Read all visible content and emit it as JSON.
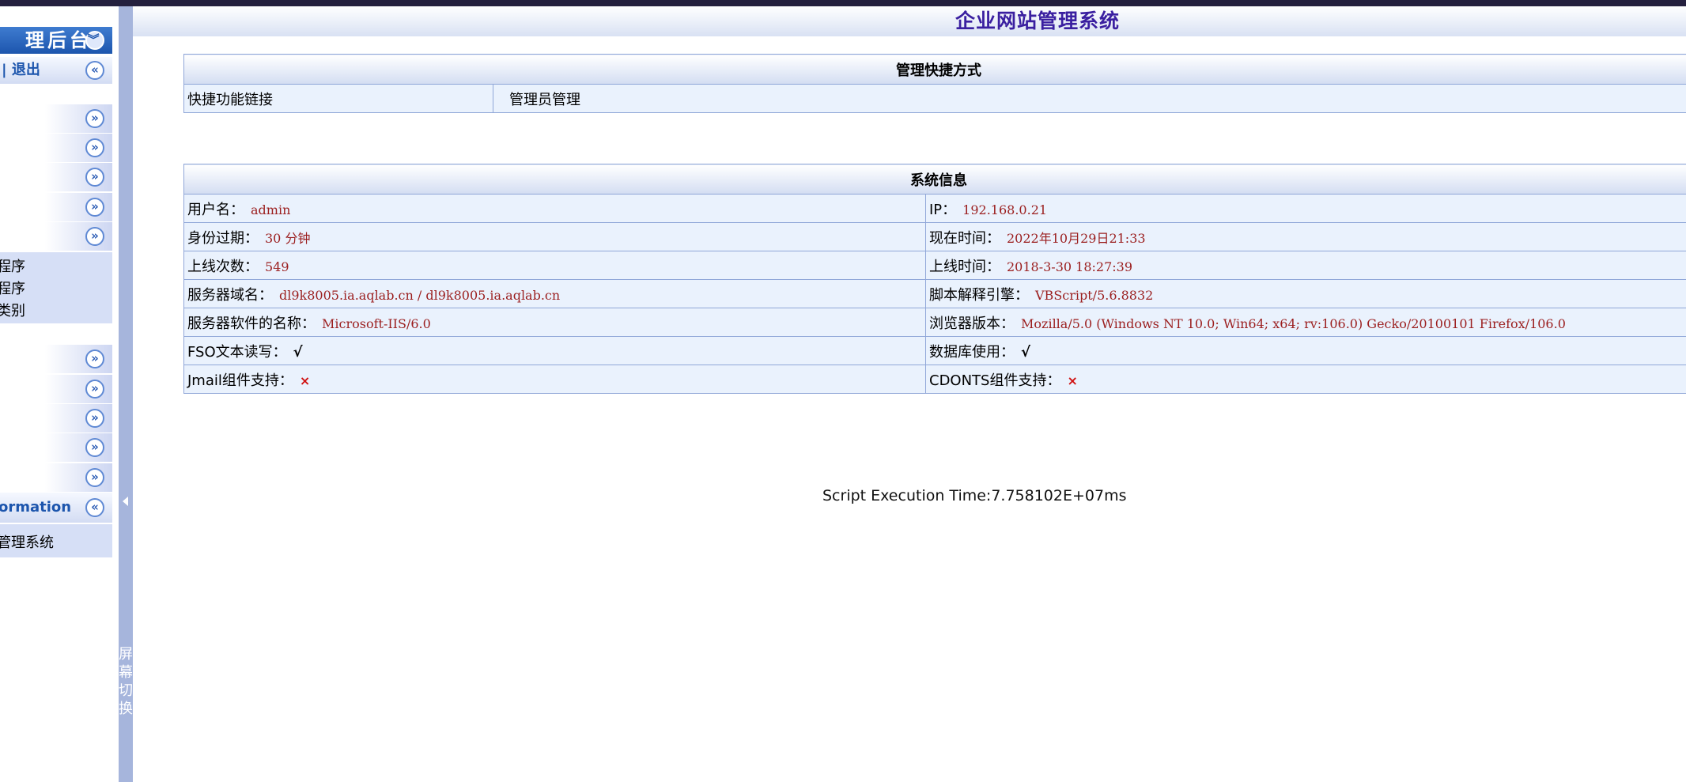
{
  "app": {
    "title": "企业网站管理系统"
  },
  "sidebar": {
    "header": "理后台",
    "logout": "| 退出",
    "group1_subitems": [
      "程序",
      "程序",
      "类别"
    ],
    "info_header": "ormation",
    "info_item": "管理系统"
  },
  "switchbar": {
    "label": "屏\n幕\n切\n换"
  },
  "shortcuts": {
    "title": "管理快捷方式",
    "label": "快捷功能链接",
    "link": "管理员管理"
  },
  "sysinfo": {
    "title": "系统信息",
    "rows": [
      {
        "left_label": "用户名：",
        "left_value": "admin",
        "right_label": "IP：",
        "right_value": "192.168.0.21"
      },
      {
        "left_label": "身份过期：",
        "left_value": "30 分钟",
        "right_label": "现在时间：",
        "right_value": "2022年10月29日21:33"
      },
      {
        "left_label": "上线次数：",
        "left_value": "549",
        "right_label": "上线时间：",
        "right_value": "2018-3-30 18:27:39"
      },
      {
        "left_label": "服务器域名：",
        "left_value": "dl9k8005.ia.aqlab.cn / dl9k8005.ia.aqlab.cn",
        "right_label": "脚本解释引擎：",
        "right_value": "VBScript/5.6.8832"
      },
      {
        "left_label": "服务器软件的名称：",
        "left_value": "Microsoft-IIS/6.0",
        "right_label": "浏览器版本：",
        "right_value": "Mozilla/5.0 (Windows NT 10.0; Win64; x64; rv:106.0) Gecko/20100101 Firefox/106.0"
      },
      {
        "left_label": "FSO文本读写：",
        "left_value": "√",
        "right_label": "数据库使用：",
        "right_value": "√"
      },
      {
        "left_label": "Jmail组件支持：",
        "left_value": "×",
        "right_label": "CDONTS组件支持：",
        "right_value": "×"
      }
    ]
  },
  "footer": {
    "exec_time": "Script Execution Time:7.758102E+07ms"
  }
}
